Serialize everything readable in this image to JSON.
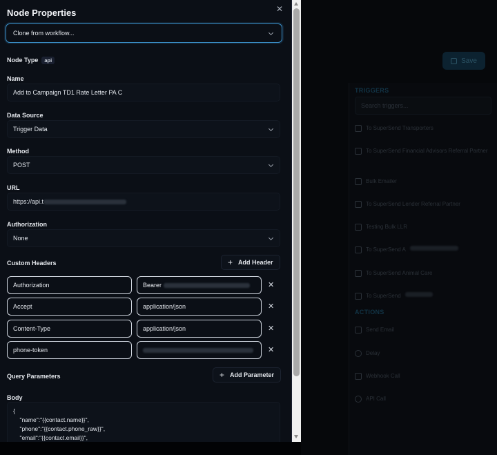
{
  "background": {
    "save_label": "Save",
    "triggers_heading": "TRIGGERS",
    "search_placeholder": "Search triggers...",
    "triggers": [
      "To SuperSend Transporters",
      "To SuperSend Financial Advisors Referral Partner",
      "Bulk Emailer",
      "To SuperSend Lender Referral Partner",
      "Testing Bulk LLR",
      "To SuperSend A",
      "To SuperSend Animal Care",
      "To SuperSend"
    ],
    "actions_heading": "ACTIONS",
    "actions": [
      {
        "label": "Send Email",
        "icon": "mail-icon"
      },
      {
        "label": "Delay",
        "icon": "clock-icon"
      },
      {
        "label": "Webhook Call",
        "icon": "webhook-icon"
      },
      {
        "label": "API Call",
        "icon": "globe-icon"
      }
    ]
  },
  "panel": {
    "title": "Node Properties",
    "clone_select": "Clone from workflow...",
    "node_type_label": "Node Type",
    "node_type_value": "api",
    "name_label": "Name",
    "name_value": "Add to Campaign TD1 Rate Letter PA C",
    "data_source_label": "Data Source",
    "data_source_value": "Trigger Data",
    "method_label": "Method",
    "method_value": "POST",
    "url_label": "URL",
    "url_value": "https://api.t",
    "authorization_label": "Authorization",
    "authorization_value": "None",
    "custom_headers_label": "Custom Headers",
    "add_header_label": "Add Header",
    "headers": [
      {
        "key": "Authorization",
        "value": "Bearer"
      },
      {
        "key": "Accept",
        "value": "application/json"
      },
      {
        "key": "Content-Type",
        "value": "application/json"
      },
      {
        "key": "phone-token",
        "value": ""
      }
    ],
    "query_params_label": "Query Parameters",
    "add_parameter_label": "Add Parameter",
    "body_label": "Body",
    "body_text": "{\n    \"name\":\"{{contact.name}}\",\n    \"phone\":\"{{contact.phone_raw}}\",\n    \"email\":\"{{contact.email}}\","
  },
  "colors": {
    "accent": "#3a8fc7",
    "panel_bg": "#0b0f16",
    "app_bg": "#06080b"
  }
}
